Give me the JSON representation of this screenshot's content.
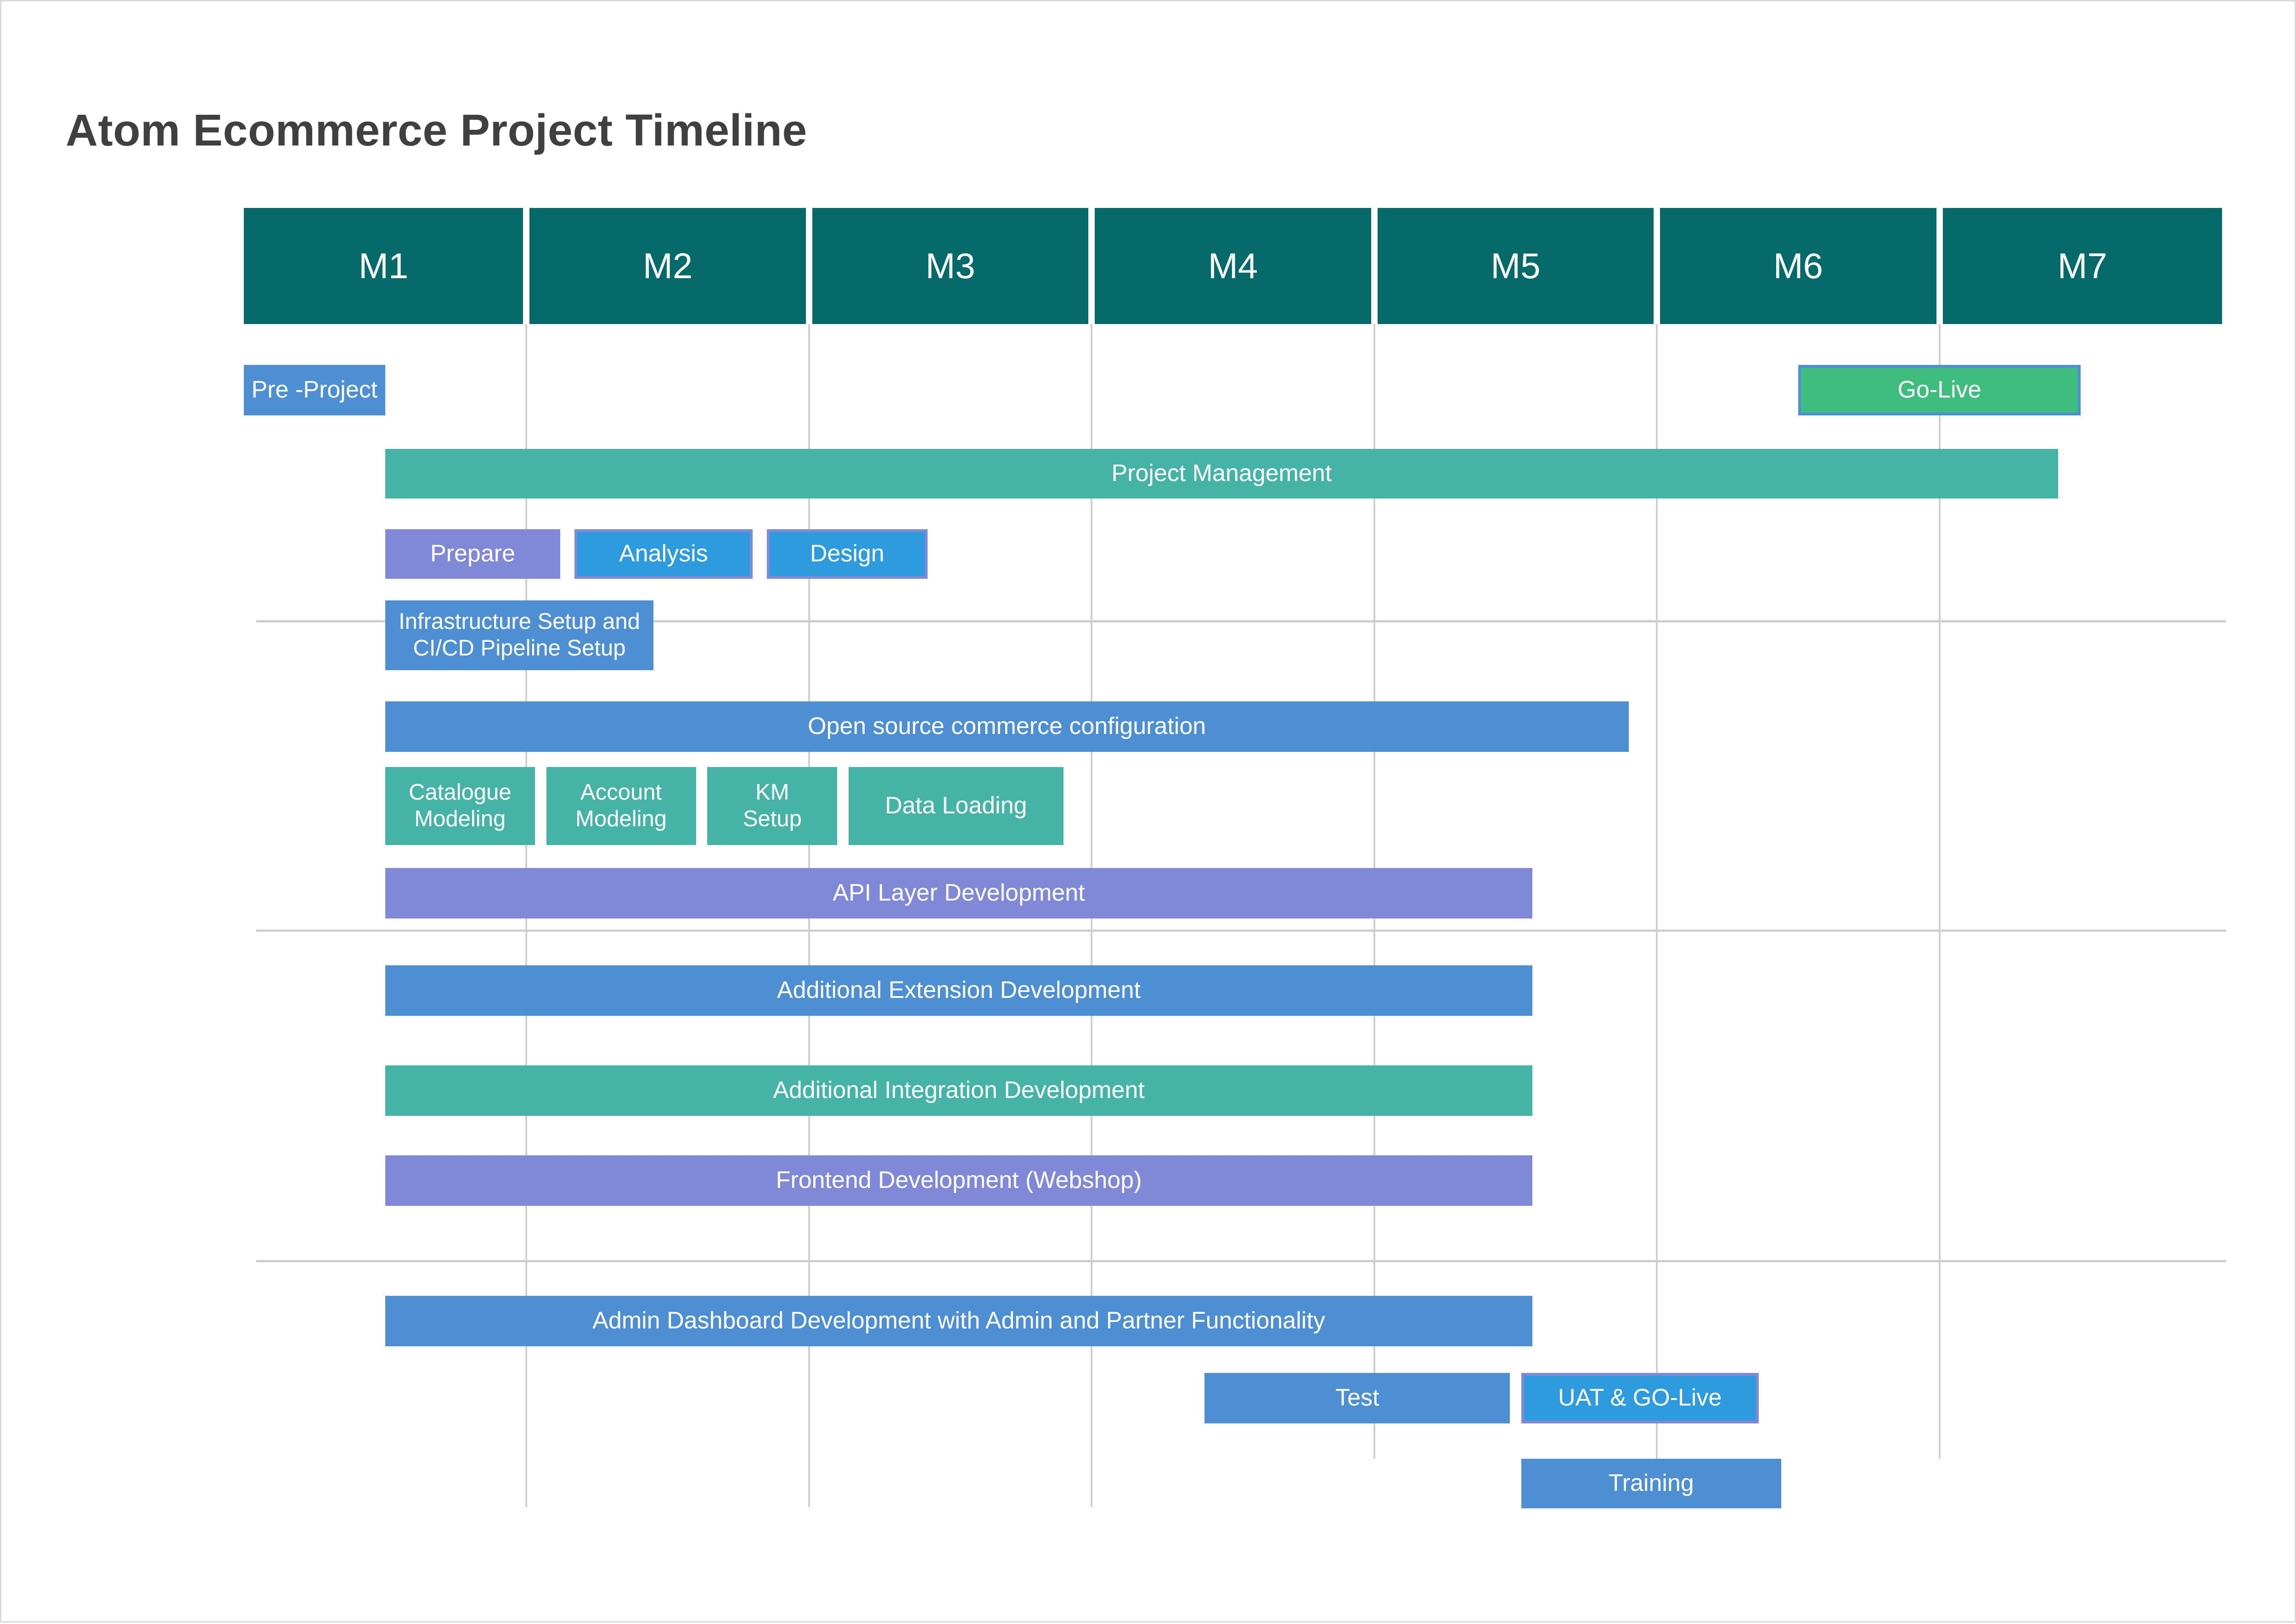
{
  "chart_data": {
    "type": "bar",
    "subtype": "gantt",
    "title": "Atom Ecommerce Project Timeline",
    "xlabel": "",
    "ylabel": "",
    "grid": true,
    "legend": "none",
    "axis": {
      "categories": [
        "M1",
        "M2",
        "M3",
        "M4",
        "M5",
        "M6",
        "M7"
      ],
      "unit": "month",
      "xlim": [
        1,
        8
      ]
    },
    "colors": {
      "header_teal": "#066a6a",
      "blue": "#4e8fd4",
      "bright_blue": "#2f9bdf",
      "purple": "#8088d8",
      "green_teal": "#45b3a5",
      "green": "#3fbd7e",
      "grid": "#cfcfcf",
      "title_text": "#404040",
      "bar_text": "#ffffff"
    },
    "tasks": [
      {
        "label": "Pre -Project",
        "start": 1.0,
        "end": 1.5,
        "color": "#4e8fd4",
        "border": "none",
        "row": 0,
        "lines": 1
      },
      {
        "label": "Go-Live",
        "start": 6.5,
        "end": 7.5,
        "color": "#3fbd7e",
        "border": "#4e8fd4",
        "row": 0,
        "lines": 1
      },
      {
        "label": "Project Management",
        "start": 1.5,
        "end": 7.42,
        "color": "#45b3a5",
        "border": "none",
        "row": 1,
        "lines": 1
      },
      {
        "label": "Prepare",
        "start": 1.5,
        "end": 2.12,
        "color": "#8088d8",
        "border": "none",
        "row": 2,
        "lines": 1
      },
      {
        "label": "Analysis",
        "start": 2.17,
        "end": 2.8,
        "color": "#2f9bdf",
        "border": "#8088d8",
        "row": 2,
        "lines": 1
      },
      {
        "label": "Design",
        "start": 2.85,
        "end": 3.42,
        "color": "#2f9bdf",
        "border": "#8088d8",
        "row": 2,
        "lines": 1
      },
      {
        "label": "Infrastructure Setup and\nCI/CD Pipeline Setup",
        "start": 1.5,
        "end": 2.45,
        "color": "#4e8fd4",
        "border": "none",
        "row": 3,
        "lines": 2
      },
      {
        "label": "Open source commerce configuration",
        "start": 1.5,
        "end": 5.9,
        "color": "#4e8fd4",
        "border": "none",
        "row": 4,
        "lines": 1
      },
      {
        "label": "Catalogue\nModeling",
        "start": 1.5,
        "end": 2.03,
        "color": "#45b3a5",
        "border": "none",
        "row": 5,
        "lines": 2
      },
      {
        "label": "Account\nModeling",
        "start": 2.07,
        "end": 2.6,
        "color": "#45b3a5",
        "border": "none",
        "row": 5,
        "lines": 2
      },
      {
        "label": "KM\nSetup",
        "start": 2.64,
        "end": 3.1,
        "color": "#45b3a5",
        "border": "none",
        "row": 5,
        "lines": 2
      },
      {
        "label": "Data Loading",
        "start": 3.14,
        "end": 3.9,
        "color": "#45b3a5",
        "border": "none",
        "row": 5,
        "lines": 1
      },
      {
        "label": "API Layer Development",
        "start": 1.5,
        "end": 5.56,
        "color": "#8088d8",
        "border": "none",
        "row": 6,
        "lines": 1
      },
      {
        "label": "Additional Extension Development",
        "start": 1.5,
        "end": 5.56,
        "color": "#4e8fd4",
        "border": "none",
        "row": 7,
        "lines": 1
      },
      {
        "label": "Additional Integration Development",
        "start": 1.5,
        "end": 5.56,
        "color": "#45b3a5",
        "border": "none",
        "row": 8,
        "lines": 1
      },
      {
        "label": "Frontend Development (Webshop)",
        "start": 1.5,
        "end": 5.56,
        "color": "#8088d8",
        "border": "none",
        "row": 9,
        "lines": 1
      },
      {
        "label": "Admin Dashboard Development with Admin and Partner Functionality",
        "start": 1.5,
        "end": 5.56,
        "color": "#4e8fd4",
        "border": "none",
        "row": 10,
        "lines": 1
      },
      {
        "label": "Test",
        "start": 4.4,
        "end": 5.48,
        "color": "#4e8fd4",
        "border": "none",
        "row": 11,
        "lines": 1
      },
      {
        "label": "UAT & GO-Live",
        "start": 5.52,
        "end": 6.36,
        "color": "#2f9bdf",
        "border": "#8088d8",
        "row": 11,
        "lines": 1
      },
      {
        "label": "Training",
        "start": 5.52,
        "end": 6.44,
        "color": "#4e8fd4",
        "border": "none",
        "row": 12,
        "lines": 1
      }
    ]
  },
  "header": {
    "title": "Atom Ecommerce Project Timeline"
  },
  "timeline": {
    "months": [
      {
        "label": "M1"
      },
      {
        "label": "M2"
      },
      {
        "label": "M3"
      },
      {
        "label": "M4"
      },
      {
        "label": "M5"
      },
      {
        "label": "M6"
      },
      {
        "label": "M7"
      }
    ]
  },
  "bars": [
    {
      "label": "Pre -Project"
    },
    {
      "label": "Go-Live"
    },
    {
      "label": "Project Management"
    },
    {
      "label": "Prepare"
    },
    {
      "label": "Analysis"
    },
    {
      "label": "Design"
    },
    {
      "label": "Infrastructure Setup and\nCI/CD Pipeline Setup"
    },
    {
      "label": "Open source commerce configuration"
    },
    {
      "label": "Catalogue\nModeling"
    },
    {
      "label": "Account\nModeling"
    },
    {
      "label": "KM\nSetup"
    },
    {
      "label": "Data Loading"
    },
    {
      "label": "API Layer Development"
    },
    {
      "label": "Additional Extension Development"
    },
    {
      "label": "Additional Integration Development"
    },
    {
      "label": "Frontend Development (Webshop)"
    },
    {
      "label": "Admin Dashboard Development with Admin and Partner Functionality"
    },
    {
      "label": "Test"
    },
    {
      "label": "UAT & GO-Live"
    },
    {
      "label": "Training"
    }
  ]
}
